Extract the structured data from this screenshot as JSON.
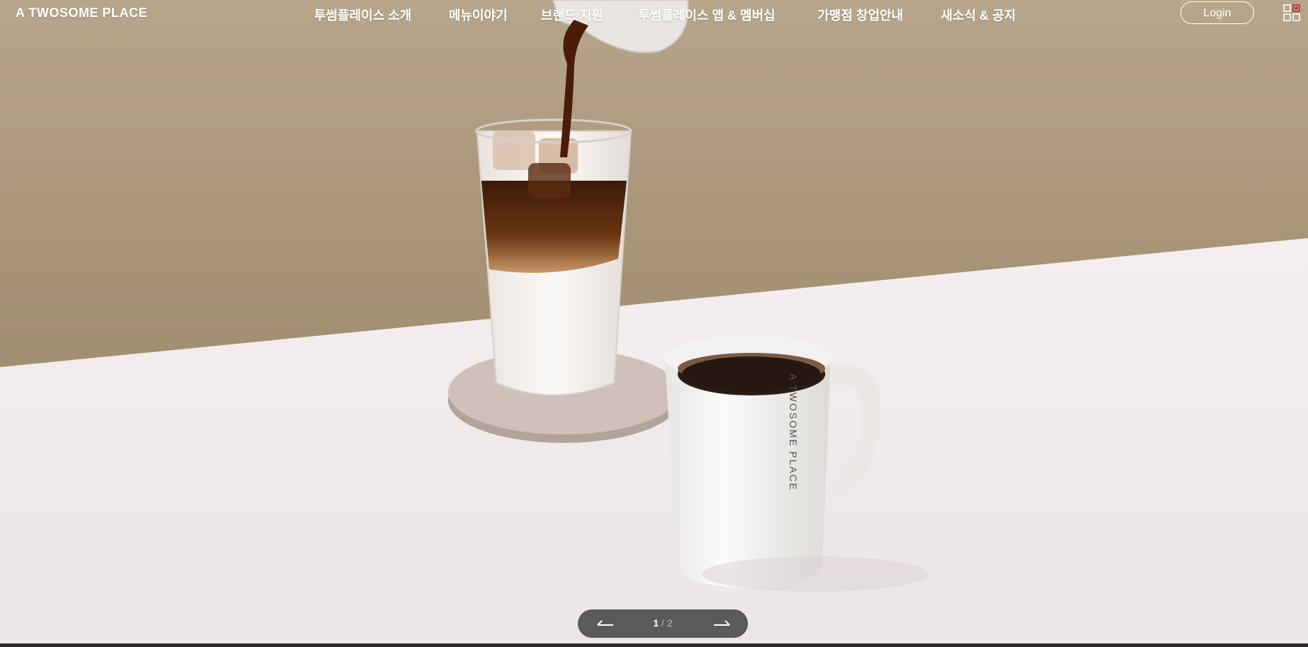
{
  "header": {
    "logo": "A TWOSOME PLACE",
    "nav": [
      "투썸플레이스 소개",
      "메뉴이야기",
      "브랜드 지원",
      "투썸플레이스 앱 & 멤버십",
      "가맹점 창업안내",
      "새소식 & 공지"
    ],
    "login_label": "Login",
    "menu_icon": "grid-menu-icon"
  },
  "hero": {
    "mug_print": "A TWOSOME PLACE"
  },
  "slider": {
    "current": "1",
    "separator": "/",
    "total": "2",
    "prev_icon": "arrow-left-icon",
    "next_icon": "arrow-right-icon"
  },
  "colors": {
    "wall": "#a99679",
    "table": "#f3eef0",
    "pager_bg": "#5a5a5c",
    "menu_accent": "#c9252c"
  }
}
